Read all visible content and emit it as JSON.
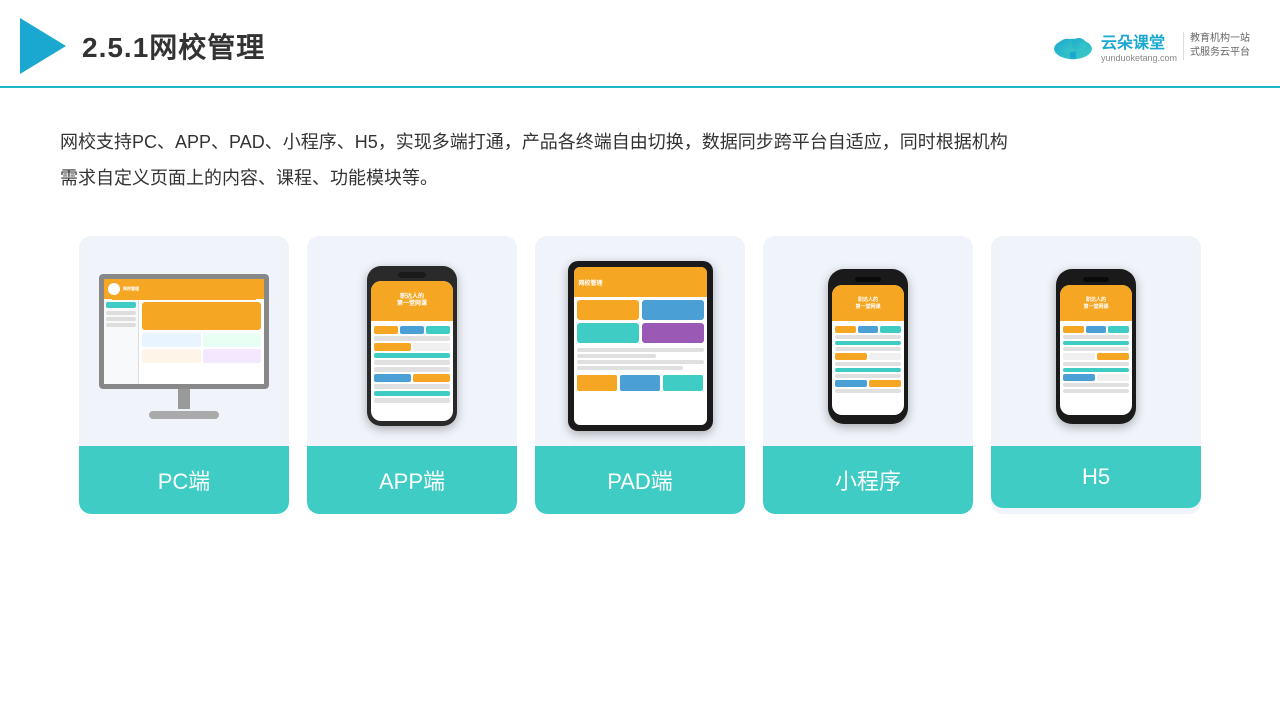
{
  "header": {
    "title": "2.5.1网校管理",
    "brand": {
      "name": "云朵课堂",
      "url": "yunduoketang.com",
      "tagline": "教育机构一站\n式服务云平台"
    }
  },
  "description": "网校支持PC、APP、PAD、小程序、H5，实现多端打通，产品各终端自由切换，数据同步跨平台自适应，同时根据机构\n需求自定义页面上的内容、课程、功能模块等。",
  "cards": [
    {
      "id": "pc",
      "label": "PC端"
    },
    {
      "id": "app",
      "label": "APP端"
    },
    {
      "id": "pad",
      "label": "PAD端"
    },
    {
      "id": "miniprogram",
      "label": "小程序"
    },
    {
      "id": "h5",
      "label": "H5"
    }
  ],
  "colors": {
    "accent": "#1aa8d0",
    "teal": "#3eccc4",
    "orange": "#f5a623",
    "border": "#1cb8c8"
  }
}
